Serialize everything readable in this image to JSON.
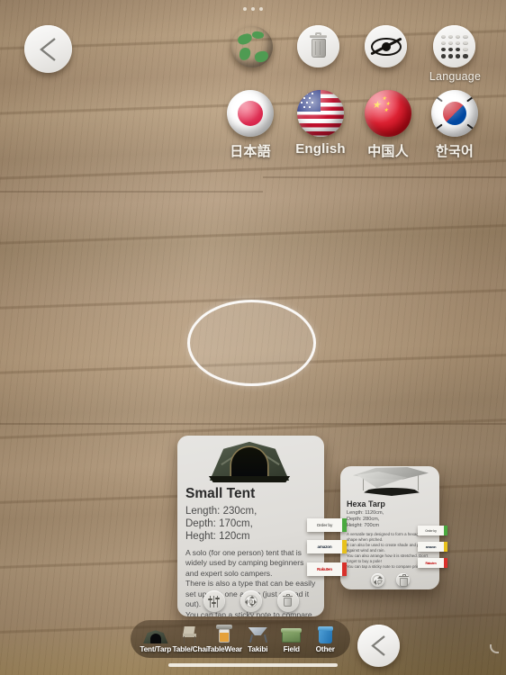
{
  "app": {
    "scene_name": "ar-camera-view",
    "status_dots": 3
  },
  "top_bar": {
    "back_label": "back",
    "tools": [
      {
        "name": "globe-icon",
        "label": ""
      },
      {
        "name": "trash-icon",
        "label": ""
      },
      {
        "name": "eye-slash-icon",
        "label": ""
      },
      {
        "name": "keypad-icon",
        "label": "Language"
      }
    ],
    "language_label": "Language"
  },
  "languages": [
    {
      "code": "ja",
      "label": "日本語",
      "flag": "japan-flag"
    },
    {
      "code": "en",
      "label": "English",
      "flag": "usa-flag"
    },
    {
      "code": "zh",
      "label": "中国人",
      "flag": "china-flag"
    },
    {
      "code": "ko",
      "label": "한국어",
      "flag": "korea-flag"
    }
  ],
  "placement_ring": {
    "name": "ar-placement-ring"
  },
  "cards": [
    {
      "id": "small-tent",
      "title": "Small Tent",
      "image": "dome-tent-image",
      "specs": "Length: 230cm,\nDepth: 170cm,\nHeght: 120cm",
      "description": "A solo (for one person) tent that is widely used by camping beginners and expert solo campers.\nThere is also a type that can be easily set up with one action (just spread it out).\nYou can tap a sticky note to compare prices!",
      "actions": [
        "settings-sliders-icon",
        "move-pad-icon",
        "trash-icon"
      ]
    },
    {
      "id": "hexa-tarp",
      "title": "Hexa Tarp",
      "image": "hexa-tarp-image",
      "specs": "Length: 1120cm,\nDepth: 280cm,\nHeight: 700cm",
      "description": "A versatile tarp designed to form a hexagonal shape when pitched.\nIt can also be used to create shade and protect against wind and rain.\nYou can also arrange how it is stretched. Don't forget to buy a pole!\nYou can tap a sticky note to compare prices!",
      "actions": [
        "move-pad-icon",
        "trash-icon"
      ]
    }
  ],
  "sticky_notes": [
    {
      "label": "Order by",
      "tab_color": "#4aa93f",
      "text_color": "#6b6b68"
    },
    {
      "label": "amazon",
      "tab_color": "#e8c11c",
      "text_color": "#232f3e"
    },
    {
      "label": "Rakuten",
      "tab_color": "#d8302a",
      "text_color": "#bf0000"
    }
  ],
  "categories": [
    {
      "id": "tent-tarp",
      "label": "Tent/Tarp",
      "icon": "tent-icon"
    },
    {
      "id": "table-chair",
      "label": "Table/Chair",
      "icon": "chair-icon"
    },
    {
      "id": "tablewear",
      "label": "TableWear",
      "icon": "jar-icon"
    },
    {
      "id": "takibi",
      "label": "Takibi",
      "icon": "firepit-icon"
    },
    {
      "id": "field",
      "label": "Field",
      "icon": "cooler-icon"
    },
    {
      "id": "other",
      "label": "Other",
      "icon": "container-icon"
    }
  ],
  "bottom_back": {
    "label": "back"
  }
}
